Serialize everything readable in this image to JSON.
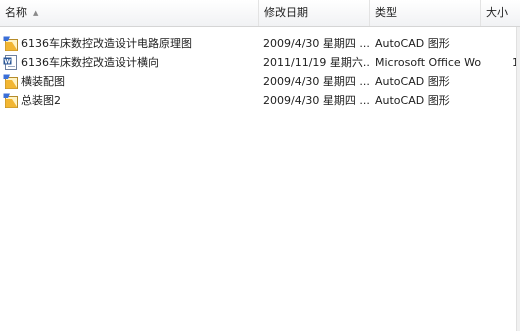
{
  "columns": {
    "name": "名称",
    "date": "修改日期",
    "type": "类型",
    "size": "大小"
  },
  "files": [
    {
      "name": "6136车床数控改造设计电路原理图",
      "date": "2009/4/30 星期四 ...",
      "type": "AutoCAD 图形",
      "size": "",
      "icon": "autocad-file-icon"
    },
    {
      "name": "6136车床数控改造设计横向",
      "date": "2011/11/19 星期六...",
      "type": "Microsoft Office Wo...",
      "size": "1,",
      "icon": "word-document-icon"
    },
    {
      "name": "横装配图",
      "date": "2009/4/30 星期四 ...",
      "type": "AutoCAD 图形",
      "size": "",
      "icon": "autocad-file-icon"
    },
    {
      "name": "总装图2",
      "date": "2009/4/30 星期四 ...",
      "type": "AutoCAD 图形",
      "size": "",
      "icon": "autocad-file-icon"
    }
  ]
}
